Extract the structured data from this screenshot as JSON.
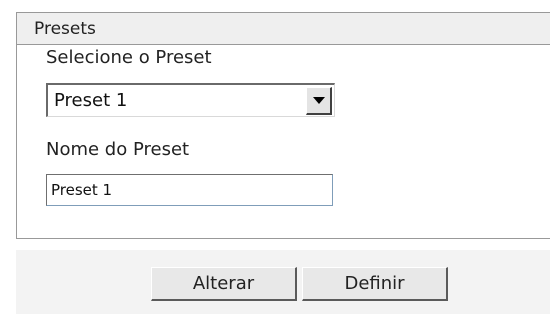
{
  "panel": {
    "title": "Presets"
  },
  "preset_select": {
    "label": "Selecione o Preset",
    "selected_value": "Preset 1"
  },
  "preset_name": {
    "label": "Nome do Preset",
    "value": "Preset 1"
  },
  "actions": {
    "alterar_label": "Alterar",
    "definir_label": "Definir"
  },
  "icons": {
    "dropdown": "chevron-down-icon"
  },
  "colors": {
    "header_bg": "#efefef",
    "border": "#999999",
    "footer_bg": "#f3f3f3"
  }
}
